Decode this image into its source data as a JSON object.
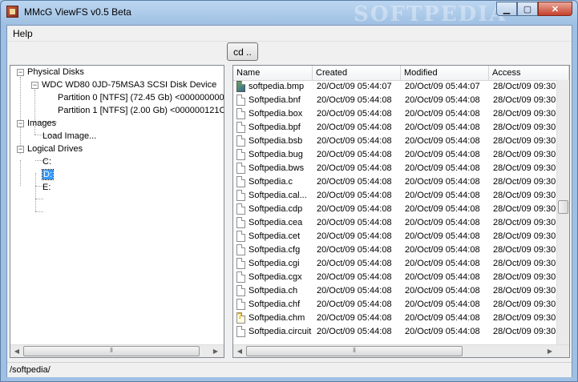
{
  "window": {
    "title": "MMcG ViewFS v0.5 Beta",
    "watermark": "SOFTPEDIA"
  },
  "caption_buttons": {
    "minimize": "▁",
    "maximize": "▢",
    "close": "✕"
  },
  "menu": {
    "help": "Help"
  },
  "toolbar": {
    "cd_label": "cd .."
  },
  "tree": {
    "physical_disks": "Physical Disks",
    "disk": "WDC WD80 0JD-75MSA3 SCSI Disk Device",
    "partition0": "Partition 0 [NTFS] (72.45 Gb) <000000000",
    "partition1": "Partition 1 [NTFS] (2.00 Gb) <000000121C",
    "images": "Images",
    "load_image": "Load Image...",
    "logical_drives": "Logical Drives",
    "drive_c": "C:",
    "drive_d": "D:",
    "drive_e": "E:"
  },
  "list": {
    "columns": [
      "Name",
      "Created",
      "Modified",
      "Access"
    ],
    "rows": [
      {
        "name": "softpedia.bmp",
        "created": "20/Oct/09 05:44:07",
        "modified": "20/Oct/09 05:44:07",
        "access": "28/Oct/09 09:30",
        "icon": "bitmap-file-icon"
      },
      {
        "name": "Softpedia.bnf",
        "created": "20/Oct/09 05:44:08",
        "modified": "20/Oct/09 05:44:08",
        "access": "28/Oct/09 09:30",
        "icon": "file-icon"
      },
      {
        "name": "Softpedia.box",
        "created": "20/Oct/09 05:44:08",
        "modified": "20/Oct/09 05:44:08",
        "access": "28/Oct/09 09:30",
        "icon": "file-icon"
      },
      {
        "name": "Softpedia.bpf",
        "created": "20/Oct/09 05:44:08",
        "modified": "20/Oct/09 05:44:08",
        "access": "28/Oct/09 09:30",
        "icon": "file-icon"
      },
      {
        "name": "Softpedia.bsb",
        "created": "20/Oct/09 05:44:08",
        "modified": "20/Oct/09 05:44:08",
        "access": "28/Oct/09 09:30",
        "icon": "file-icon"
      },
      {
        "name": "Softpedia.bug",
        "created": "20/Oct/09 05:44:08",
        "modified": "20/Oct/09 05:44:08",
        "access": "28/Oct/09 09:30",
        "icon": "file-icon"
      },
      {
        "name": "Softpedia.bws",
        "created": "20/Oct/09 05:44:08",
        "modified": "20/Oct/09 05:44:08",
        "access": "28/Oct/09 09:30",
        "icon": "file-icon"
      },
      {
        "name": "Softpedia.c",
        "created": "20/Oct/09 05:44:08",
        "modified": "20/Oct/09 05:44:08",
        "access": "28/Oct/09 09:30",
        "icon": "file-icon"
      },
      {
        "name": "Softpedia.cal...",
        "created": "20/Oct/09 05:44:08",
        "modified": "20/Oct/09 05:44:08",
        "access": "28/Oct/09 09:30",
        "icon": "file-icon"
      },
      {
        "name": "Softpedia.cdp",
        "created": "20/Oct/09 05:44:08",
        "modified": "20/Oct/09 05:44:08",
        "access": "28/Oct/09 09:30",
        "icon": "file-icon"
      },
      {
        "name": "Softpedia.cea",
        "created": "20/Oct/09 05:44:08",
        "modified": "20/Oct/09 05:44:08",
        "access": "28/Oct/09 09:30",
        "icon": "file-icon"
      },
      {
        "name": "Softpedia.cet",
        "created": "20/Oct/09 05:44:08",
        "modified": "20/Oct/09 05:44:08",
        "access": "28/Oct/09 09:30",
        "icon": "file-icon"
      },
      {
        "name": "Softpedia.cfg",
        "created": "20/Oct/09 05:44:08",
        "modified": "20/Oct/09 05:44:08",
        "access": "28/Oct/09 09:30",
        "icon": "file-icon"
      },
      {
        "name": "Softpedia.cgi",
        "created": "20/Oct/09 05:44:08",
        "modified": "20/Oct/09 05:44:08",
        "access": "28/Oct/09 09:30",
        "icon": "file-icon"
      },
      {
        "name": "Softpedia.cgx",
        "created": "20/Oct/09 05:44:08",
        "modified": "20/Oct/09 05:44:08",
        "access": "28/Oct/09 09:30",
        "icon": "file-icon"
      },
      {
        "name": "Softpedia.ch",
        "created": "20/Oct/09 05:44:08",
        "modified": "20/Oct/09 05:44:08",
        "access": "28/Oct/09 09:30",
        "icon": "file-icon"
      },
      {
        "name": "Softpedia.chf",
        "created": "20/Oct/09 05:44:08",
        "modified": "20/Oct/09 05:44:08",
        "access": "28/Oct/09 09:30",
        "icon": "file-icon"
      },
      {
        "name": "Softpedia.chm",
        "created": "20/Oct/09 05:44:08",
        "modified": "20/Oct/09 05:44:08",
        "access": "28/Oct/09 09:30",
        "icon": "help-file-icon"
      },
      {
        "name": "Softpedia.circuit",
        "created": "20/Oct/09 05:44:08",
        "modified": "20/Oct/09 05:44:08",
        "access": "28/Oct/09 09:30",
        "icon": "file-icon"
      }
    ]
  },
  "status": {
    "path": "/softpedia/"
  }
}
